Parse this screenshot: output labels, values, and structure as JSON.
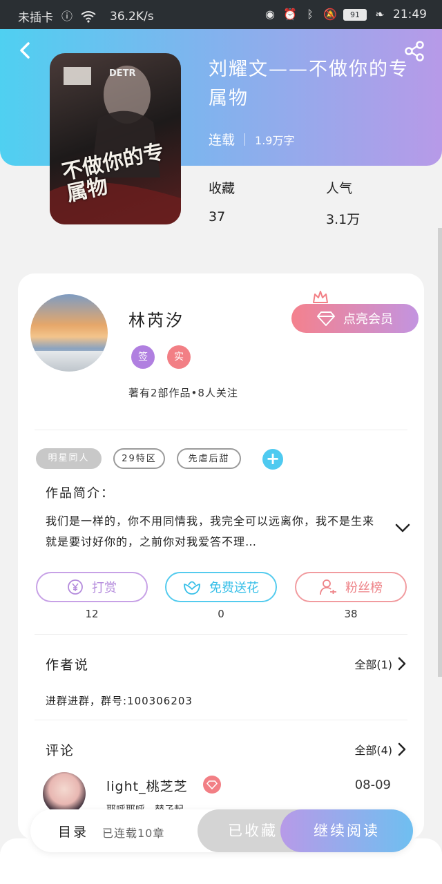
{
  "status_bar": {
    "carrier": "未插卡",
    "speed": "36.2K/s",
    "battery": "91",
    "time": "21:49"
  },
  "book": {
    "cover_title": "不做你的专属物",
    "cover_tag": "DETR",
    "title": "刘耀文——不做你的专属物",
    "status": "连载",
    "words": "1.9万字",
    "collect_label": "收藏",
    "collect_value": "37",
    "popularity_label": "人气",
    "popularity_value": "3.1万"
  },
  "author": {
    "name": "林芮汐",
    "badge_sign": "签",
    "badge_real": "实",
    "stats": "著有2部作品•8人关注",
    "vip_label": "点亮会员"
  },
  "tags": [
    "明星同人",
    "29特区",
    "先虐后甜"
  ],
  "intro": {
    "heading": "作品简介：",
    "text": "我们是一样的，你不用同情我，我完全可以远离你，我不是生来就是要讨好你的，之前你对我爱答不理…"
  },
  "actions": {
    "reward_label": "打赏",
    "reward_count": "12",
    "flower_label": "免费送花",
    "flower_count": "0",
    "fans_label": "粉丝榜",
    "fans_count": "38"
  },
  "author_says": {
    "heading": "作者说",
    "more": "全部(1)",
    "text": "进群进群，群号:100306203"
  },
  "comments": {
    "heading": "评论",
    "more": "全部(4)",
    "items": [
      {
        "user": "light_桃芝芝",
        "date": "08-09",
        "text": "耶呼耶呼，替孑起……"
      }
    ]
  },
  "bottom": {
    "toc_label": "目录",
    "toc_count": "已连载10章",
    "collected_label": "已收藏",
    "continue_label": "继续阅读"
  },
  "colors": {
    "accent_blue": "#4fd0f1",
    "accent_purple": "#b79ae8",
    "accent_pink": "#f27f85"
  }
}
